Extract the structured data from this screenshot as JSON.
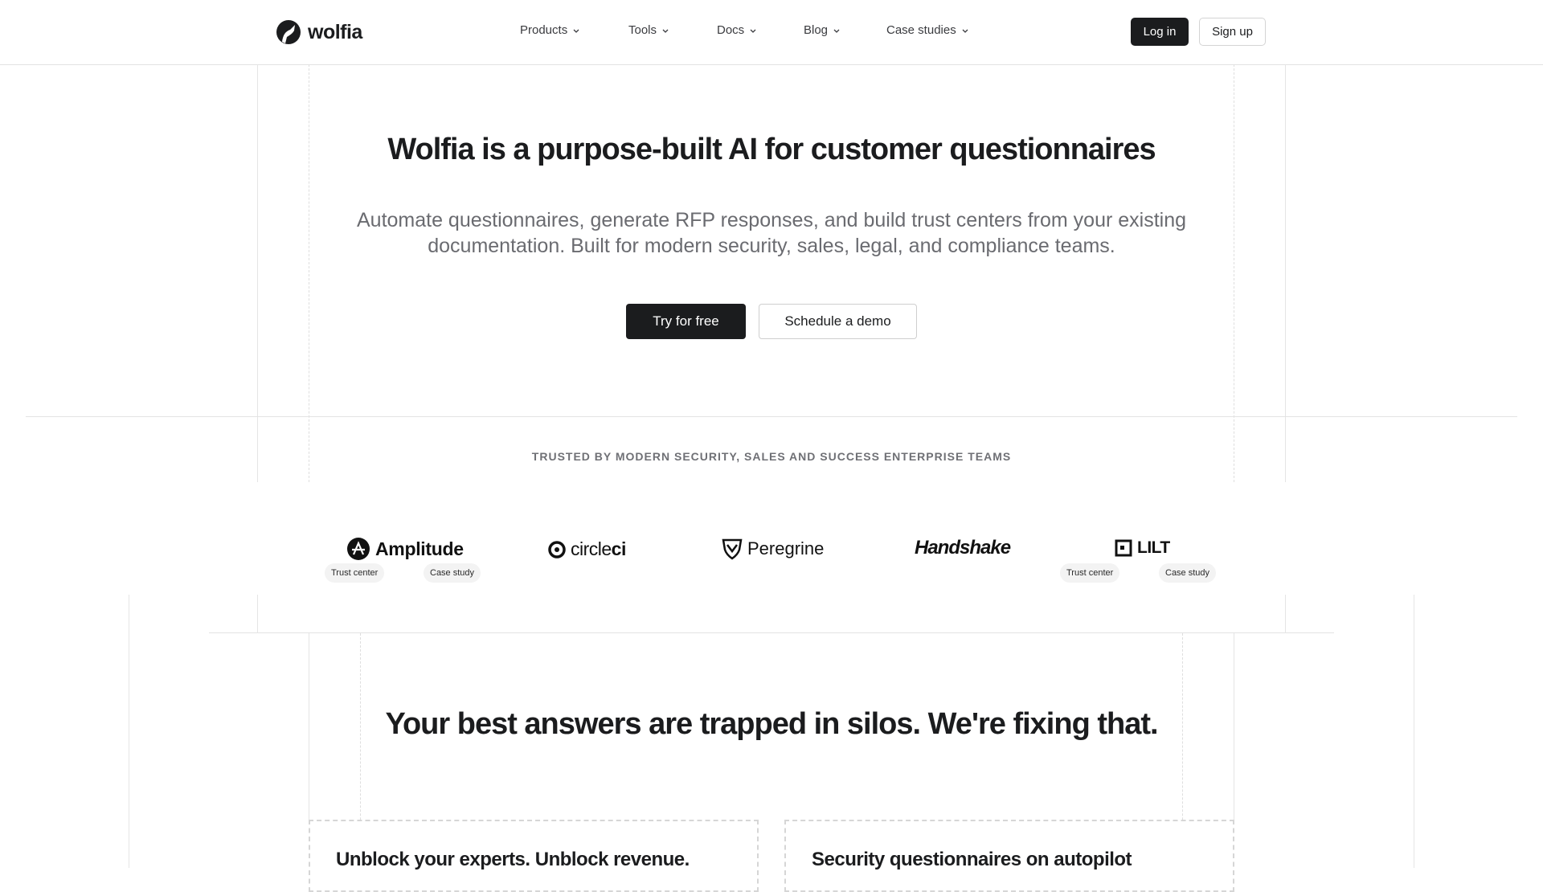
{
  "header": {
    "logo_text": "wolfia",
    "nav": [
      {
        "label": "Products"
      },
      {
        "label": "Tools"
      },
      {
        "label": "Docs"
      },
      {
        "label": "Blog"
      },
      {
        "label": "Case studies"
      }
    ],
    "login_label": "Log in",
    "signup_label": "Sign up"
  },
  "hero": {
    "title": "Wolfia is a purpose-built AI for customer questionnaires",
    "subtitle_line1": "Automate questionnaires, generate RFP responses, and build trust centers from your existing",
    "subtitle_line2": "documentation. Built for modern security, sales, legal, and compliance teams.",
    "try_label": "Try for free",
    "demo_label": "Schedule a demo"
  },
  "trusted": {
    "heading": "TRUSTED BY MODERN SECURITY, SALES AND SUCCESS ENTERPRISE TEAMS",
    "brands": [
      {
        "name": "Amplitude",
        "icon": "amplitude-logo-icon",
        "links": [
          "Trust center",
          "Case study"
        ]
      },
      {
        "name_prefix": "circle",
        "name_suffix": "ci",
        "icon": "circleci-logo-icon"
      },
      {
        "name": "Peregrine",
        "icon": "peregrine-shield-icon"
      },
      {
        "name": "Handshake"
      },
      {
        "name": "LILT",
        "icon": "lilt-logo-icon",
        "links": [
          "Trust center",
          "Case study"
        ]
      }
    ]
  },
  "silos": {
    "title": "Your best answers are trapped in silos. We're fixing that.",
    "cards": [
      {
        "title": "Unblock your experts. Unblock revenue."
      },
      {
        "title": "Security questionnaires on autopilot"
      }
    ]
  },
  "colors": {
    "primary": "#1b1c1e",
    "muted_text": "#6a6b70",
    "grid_line": "#e5e5e5",
    "pill_bg": "#f3f3f3"
  }
}
